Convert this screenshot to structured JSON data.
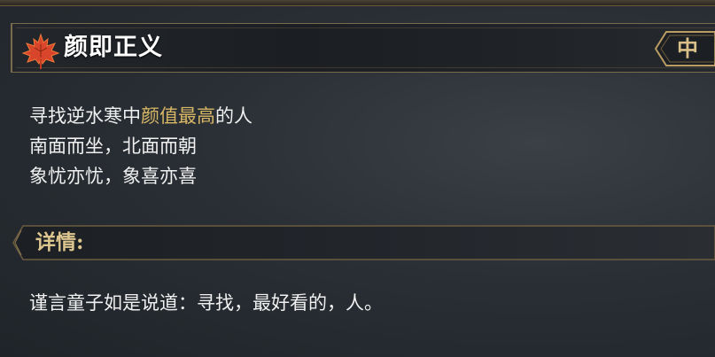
{
  "quest": {
    "title": "颜即正义",
    "badge": "中",
    "lines": [
      {
        "pre": "寻找逆水寒中",
        "highlight": "颜值最高",
        "post": "的人"
      },
      {
        "text": "南面而坐，北面而朝"
      },
      {
        "text": "象忧亦忧，象喜亦喜"
      }
    ],
    "detail_label": "详情:",
    "detail_text": "谨言童子如是说道：寻找，最好看的，人。"
  },
  "colors": {
    "highlight": "#d8b765",
    "gold_label": "#dcc58e",
    "leaf": "#d8452a"
  },
  "icons": {
    "title_icon": "maple-leaf-icon",
    "badge_frame": "arrow-badge-frame"
  }
}
